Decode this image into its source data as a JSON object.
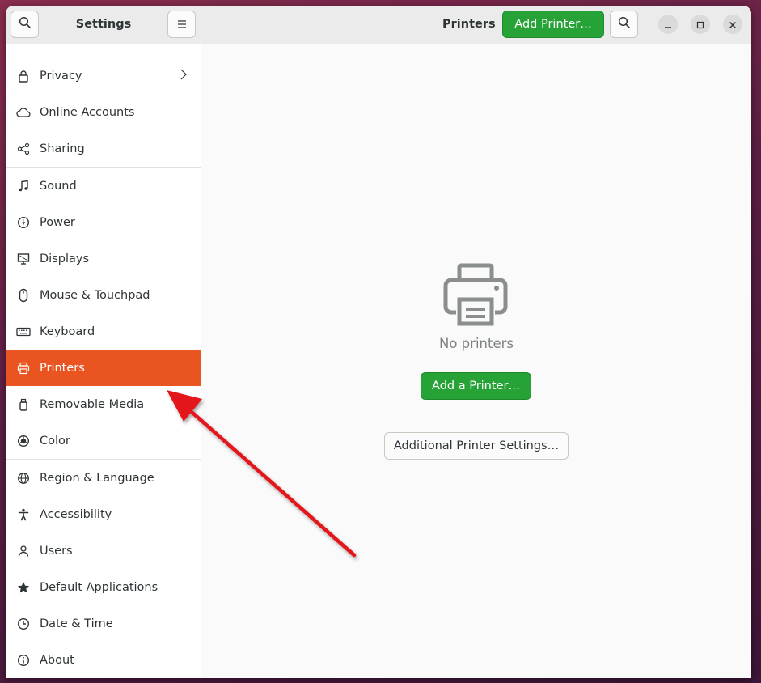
{
  "sidebar": {
    "title": "Settings",
    "items": [
      {
        "label": "Privacy",
        "icon": "lock-icon"
      },
      {
        "label": "Online Accounts",
        "icon": "cloud-icon"
      },
      {
        "label": "Sharing",
        "icon": "share-icon"
      },
      {
        "label": "Sound",
        "icon": "music-note-icon"
      },
      {
        "label": "Power",
        "icon": "power-icon"
      },
      {
        "label": "Displays",
        "icon": "display-icon"
      },
      {
        "label": "Mouse & Touchpad",
        "icon": "mouse-icon"
      },
      {
        "label": "Keyboard",
        "icon": "keyboard-icon"
      },
      {
        "label": "Printers",
        "icon": "printer-icon",
        "active": true
      },
      {
        "label": "Removable Media",
        "icon": "usb-drive-icon"
      },
      {
        "label": "Color",
        "icon": "color-icon"
      },
      {
        "label": "Region & Language",
        "icon": "globe-icon"
      },
      {
        "label": "Accessibility",
        "icon": "accessibility-icon"
      },
      {
        "label": "Users",
        "icon": "users-icon"
      },
      {
        "label": "Default Applications",
        "icon": "star-icon"
      },
      {
        "label": "Date & Time",
        "icon": "clock-icon"
      },
      {
        "label": "About",
        "icon": "info-icon"
      }
    ]
  },
  "header": {
    "title": "Printers",
    "add_printer_label": "Add Printer…"
  },
  "main": {
    "empty_label": "No printers",
    "add_a_printer_label": "Add a Printer…",
    "additional_settings_label": "Additional Printer Settings…"
  },
  "colors": {
    "accent": "#e95420",
    "suggested_action": "#26a236",
    "annotation_arrow": "#e3161b"
  }
}
